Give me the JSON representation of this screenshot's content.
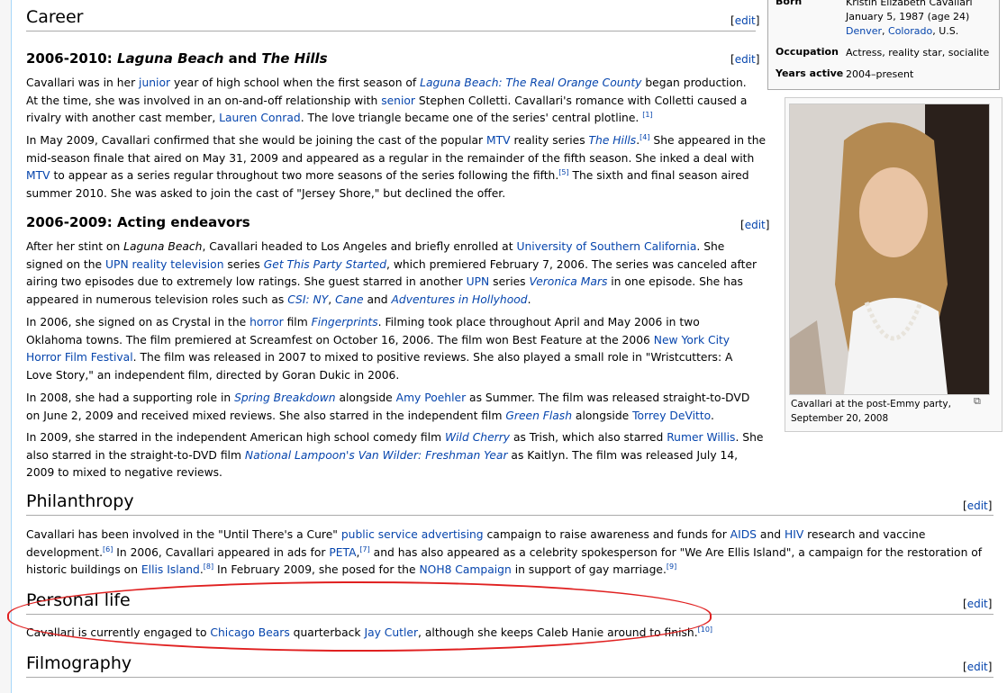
{
  "infobox": {
    "born_label": "Born",
    "born_name": "Kristin Elizabeth Cavallari",
    "born_date": "January 5, 1987 (age 24)",
    "born_place_1": "Denver",
    "born_place_sep": ", ",
    "born_place_2": "Colorado",
    "born_place_3": ", U.S.",
    "occupation_label": "Occupation",
    "occupation": "Actress, reality star, socialite",
    "years_label": "Years active",
    "years": "2004–present"
  },
  "thumb": {
    "caption": "Cavallari at the post-Emmy party, September 20, 2008"
  },
  "edit_label": "edit",
  "sections": {
    "career": "Career",
    "lb": {
      "pre": "2006-2010: ",
      "a": "Laguna Beach",
      "mid": " and ",
      "b": "The Hills"
    },
    "acting": "2006-2009: Acting endeavors",
    "philanthropy": "Philanthropy",
    "personal": "Personal life",
    "filmography": "Filmography"
  },
  "p1": {
    "t1": "Cavallari was in her ",
    "l1": "junior",
    "t2": " year of high school when the first season of ",
    "l2": "Laguna Beach: The Real Orange County",
    "t3": " began production. At the time, she was involved in an on-and-off relationship with ",
    "l3": "senior",
    "t4": " Stephen Colletti. Cavallari's romance with Colletti caused a rivalry with another cast member, ",
    "l4": "Lauren Conrad",
    "t5": ". The love triangle became one of the series' central plotline. ",
    "r1": "[1]"
  },
  "p2": {
    "t1": "In May 2009, Cavallari confirmed that she would be joining the cast of the popular ",
    "l1": "MTV",
    "t2": " reality series ",
    "l2": "The Hills",
    "t3": ".",
    "r1": "[4]",
    "t4": " She appeared in the mid-season finale that aired on May 31, 2009 and appeared as a regular in the remainder of the fifth season. She inked a deal with ",
    "l3": "MTV",
    "t5": " to appear as a series regular throughout two more seasons of the series following the fifth.",
    "r2": "[5]",
    "t6": " The sixth and final season aired summer 2010. She was asked to join the cast of \"Jersey Shore,\" but declined the offer."
  },
  "p3": {
    "t1": "After her stint on ",
    "i1": "Laguna Beach",
    "t2": ", Cavallari headed to Los Angeles and briefly enrolled at ",
    "l1": "University of Southern California",
    "t3": ". She signed on the ",
    "l2": "UPN reality television",
    "t4": " series ",
    "l3": "Get This Party Started",
    "t5": ", which premiered February 7, 2006. The series was canceled after airing two episodes due to extremely low ratings. She guest starred in another ",
    "l4": "UPN",
    "t6": " series ",
    "l5": "Veronica Mars",
    "t7": " in one episode. She has appeared in numerous television roles such as ",
    "l6": "CSI: NY",
    "t8": ", ",
    "l7": "Cane",
    "t9": " and ",
    "l8": "Adventures in Hollyhood",
    "t10": "."
  },
  "p4": {
    "t1": "In 2006, she signed on as Crystal in the ",
    "l1": "horror",
    "t2": " film ",
    "l2": "Fingerprints",
    "t3": ". Filming took place throughout April and May 2006 in two Oklahoma towns. The film premiered at Screamfest on October 16, 2006. The film won Best Feature at the 2006 ",
    "l3": "New York City Horror Film Festival",
    "t4": ". The film was released in 2007 to mixed to positive reviews. She also played a small role in \"Wristcutters: A Love Story,\" an independent film, directed by Goran Dukic in 2006."
  },
  "p5": {
    "t1": "In 2008, she had a supporting role in ",
    "l1": "Spring Breakdown",
    "t2": " alongside ",
    "l2": "Amy Poehler",
    "t3": " as Summer. The film was released straight-to-DVD on June 2, 2009 and received mixed reviews. She also starred in the independent film ",
    "l3": "Green Flash",
    "t4": " alongside ",
    "l4": "Torrey DeVitto",
    "t5": "."
  },
  "p6": {
    "t1": "In 2009, she starred in the independent American high school comedy film ",
    "l1": "Wild Cherry",
    "t2": " as Trish, which also starred ",
    "l2": "Rumer Willis",
    "t3": ". She also starred in the straight-to-DVD film ",
    "l3": "National Lampoon's Van Wilder: Freshman Year",
    "t4": " as Kaitlyn. The film was released July 14, 2009 to mixed to negative reviews."
  },
  "p7": {
    "t1": "Cavallari has been involved in the \"Until There's a Cure\" ",
    "l1": "public service advertising",
    "t2": " campaign to raise awareness and funds for ",
    "l2": "AIDS",
    "t3": " and ",
    "l3": "HIV",
    "t4": " research and vaccine development.",
    "r1": "[6]",
    "t5": " In 2006, Cavallari appeared in ads for ",
    "l4": "PETA",
    "t6": ",",
    "r2": "[7]",
    "t7": " and has also appeared as a celebrity spokesperson for \"We Are Ellis Island\", a campaign for the restoration of historic buildings on ",
    "l5": "Ellis Island",
    "t8": ".",
    "r3": "[8]",
    "t9": " In February 2009, she posed for the ",
    "l6": "NOH8 Campaign",
    "t10": " in support of gay marriage.",
    "r4": "[9]"
  },
  "p8": {
    "t1": "Cavallari is currently engaged to ",
    "l1": "Chicago Bears",
    "t2": " quarterback ",
    "l2": "Jay Cutler",
    "t3": ", although she keeps Caleb Hanie around to finish.",
    "r1": "[10]"
  }
}
